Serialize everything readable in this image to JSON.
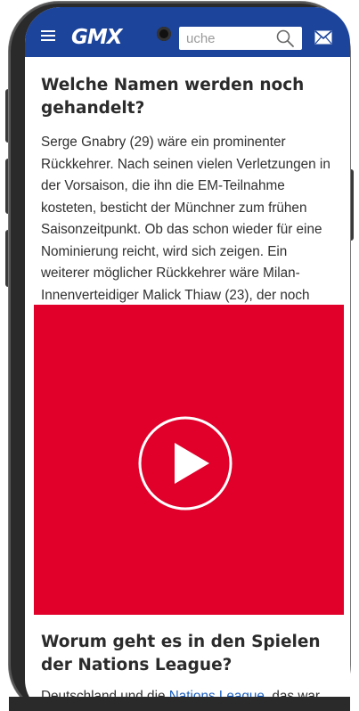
{
  "header": {
    "logo": "GMX",
    "search_placeholder": "uche",
    "brand_color": "#1c449b"
  },
  "article": {
    "heading_1": "Welche Namen werden noch gehandelt?",
    "paragraph_1": "Serge Gnabry (29) wäre ein prominenter Rückkehrer. Nach seinen vielen Verletzungen in der Vorsaison, die ihn die EM-Teilnahme kosteten, besticht der Münchner zum frühen Saisonzeitpunkt. Ob das schon wieder für eine Nominierung reicht, wird sich zeigen. Ein weiterer möglicher Rückkehrer wäre Milan-Innenverteidiger Malick Thiaw (23), der noch",
    "heading_2": "Worum geht es in den Spielen der Nations League?",
    "paragraph_2_start": "Deutschland und die ",
    "paragraph_2_link": "Nations League",
    "paragraph_2_end": ", das war"
  },
  "video": {
    "background_color": "#e0002a",
    "icon": "play-icon"
  },
  "icons": {
    "menu": "hamburger-menu-icon",
    "search": "search-icon",
    "mail": "mail-icon"
  }
}
